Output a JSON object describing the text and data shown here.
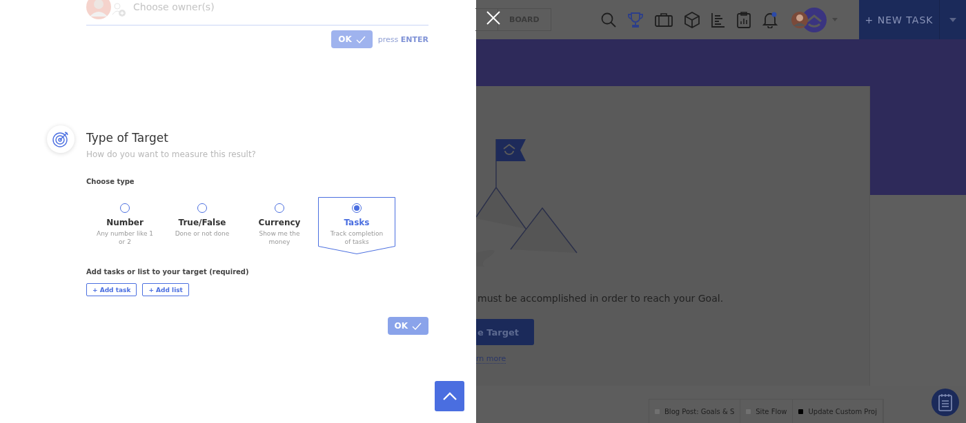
{
  "owner_field": {
    "placeholder": "Choose owner(s)"
  },
  "owner_confirm": {
    "button": "OK",
    "hint": "press **ENTER**"
  },
  "section": {
    "title": "Type of Target",
    "subtitle": "How do you want to measure this result?",
    "choose_label": "Choose type",
    "types": [
      {
        "name": "Number",
        "description": "Any number like 1 or 2",
        "selected": false
      },
      {
        "name": "True/False",
        "description": "Done or not done",
        "selected": false
      },
      {
        "name": "Currency",
        "description": "Show me the money",
        "selected": false
      },
      {
        "name": "Tasks",
        "description": "Track completion of tasks",
        "selected": true
      }
    ],
    "add_label": "Add tasks or list to your target (required)",
    "add_buttons": [
      "+ Add task",
      "+ Add list"
    ],
    "ok_button": "OK"
  },
  "background": {
    "view_tabs": [
      "BOARD"
    ],
    "notification_unread": true,
    "new_task_button": "+ NEW TASK",
    "description": "must be accomplished in order to reach your Goal.",
    "primary_button": "e Target",
    "link": "rn more",
    "bottom_tabs": [
      {
        "label": "Blog Post: Goals & S",
        "color": "#707070"
      },
      {
        "label": "Site Flow",
        "color": "#707070"
      },
      {
        "label": "Update Custom Proj",
        "color": "#000000"
      }
    ]
  }
}
